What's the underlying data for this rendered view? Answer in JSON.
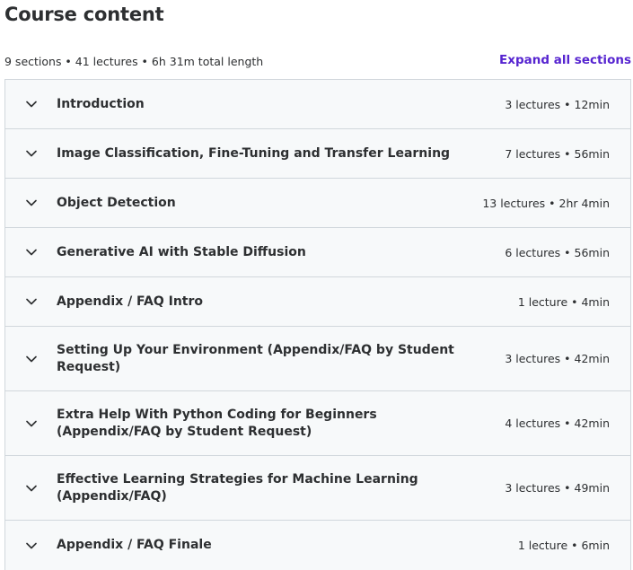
{
  "header": {
    "title": "Course content",
    "summary": "9 sections • 41 lectures • 6h 31m total length",
    "expand_label": "Expand all sections"
  },
  "icons": {
    "section_toggle": "chevron-down-icon"
  },
  "colors": {
    "accent": "#5624d0",
    "section_bg": "#f7f9fa",
    "border": "#d1d7dc",
    "text": "#2d2f31"
  },
  "sections": [
    {
      "title": "Introduction",
      "meta": "3 lectures • 12min"
    },
    {
      "title": "Image Classification, Fine-Tuning and Transfer Learning",
      "meta": "7 lectures • 56min"
    },
    {
      "title": "Object Detection",
      "meta": "13 lectures • 2hr 4min"
    },
    {
      "title": "Generative AI with Stable Diffusion",
      "meta": "6 lectures • 56min"
    },
    {
      "title": "Appendix / FAQ Intro",
      "meta": "1 lecture • 4min"
    },
    {
      "title": "Setting Up Your Environment (Appendix/FAQ by Student Request)",
      "meta": "3 lectures • 42min"
    },
    {
      "title": "Extra Help With Python Coding for Beginners (Appendix/FAQ by Student Request)",
      "meta": "4 lectures • 42min"
    },
    {
      "title": "Effective Learning Strategies for Machine Learning (Appendix/FAQ)",
      "meta": "3 lectures • 49min"
    },
    {
      "title": "Appendix / FAQ Finale",
      "meta": "1 lecture • 6min"
    }
  ]
}
